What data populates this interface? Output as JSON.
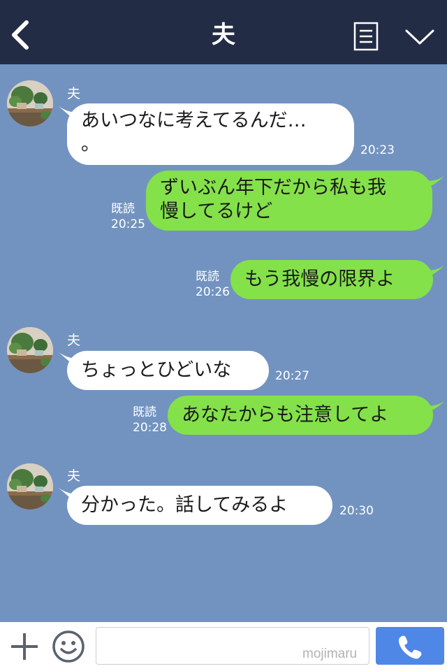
{
  "header": {
    "title": "夫",
    "back_icon": "chevron-left-icon",
    "menu_icon": "document-list-icon",
    "collapse_icon": "chevron-down-icon",
    "background": "#232c45"
  },
  "chat": {
    "background": "#7293c0",
    "incoming_bubble_color": "#ffffff",
    "outgoing_bubble_color": "#84e14a",
    "messages": [
      {
        "direction": "in",
        "sender": "夫",
        "lines": [
          "あいつなに考えてるんだ…",
          "。"
        ],
        "time": "20:23"
      },
      {
        "direction": "out",
        "read_label": "既読",
        "lines": [
          "ずいぶん年下だから私も我",
          "慢してるけど"
        ],
        "time": "20:25"
      },
      {
        "direction": "out",
        "read_label": "既読",
        "lines": [
          "もう我慢の限界よ"
        ],
        "time": "20:26"
      },
      {
        "direction": "in",
        "sender": "夫",
        "lines": [
          "ちょっとひどいな"
        ],
        "time": "20:27"
      },
      {
        "direction": "out",
        "read_label": "既読",
        "lines": [
          "あなたからも注意してよ"
        ],
        "time": "20:28"
      },
      {
        "direction": "in",
        "sender": "夫",
        "lines": [
          "分かった。話してみるよ"
        ],
        "time": "20:30"
      }
    ]
  },
  "footer": {
    "plus_icon": "plus-icon",
    "emoji_icon": "smiley-icon",
    "input_value": "",
    "watermark": "mojimaru",
    "call_icon": "phone-icon",
    "call_button_color": "#4f87e6"
  }
}
